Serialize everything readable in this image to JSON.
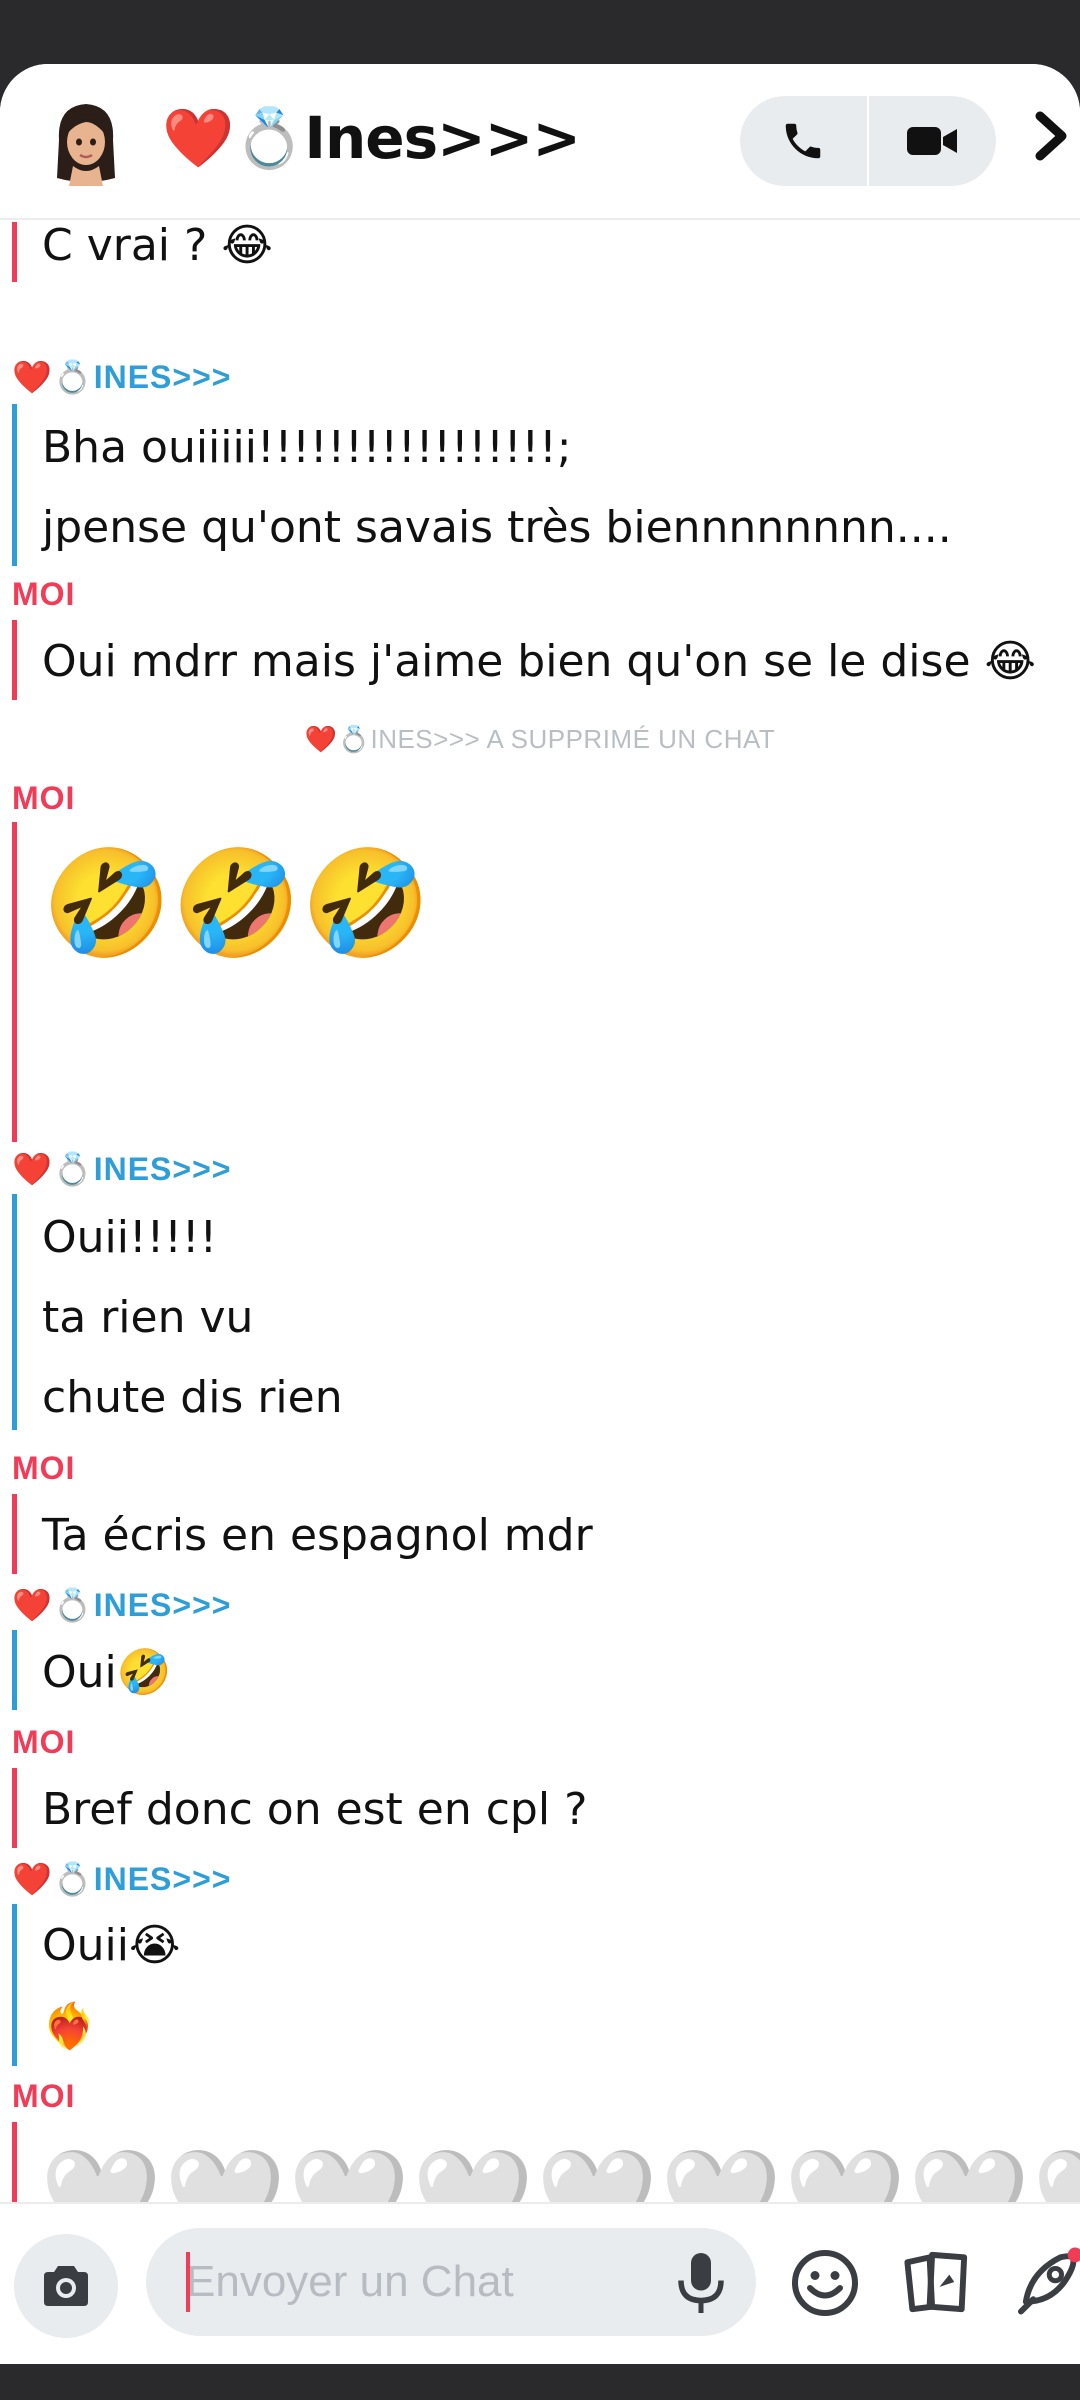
{
  "header": {
    "title": "❤️💍Ines>>>",
    "call_icon": "phone-icon",
    "video_icon": "video-camera-icon",
    "more_icon": "chevron-right-icon"
  },
  "colors": {
    "moi": "#f23c57",
    "ines": "#2d9ed8",
    "system_text": "#b9bec4",
    "pill_bg": "#e9ecef"
  },
  "chat": {
    "blocks": [
      {
        "sender": "",
        "sender_class": "moi",
        "messages": [
          "C vrai ? 😂"
        ]
      },
      {
        "sender": "❤️💍INES>>>",
        "sender_class": "ines",
        "messages": [
          "Bha ouiiiii!!!!!!!!!!!!!!!!!;",
          "jpense qu'ont savais très biennnnnnnn...."
        ]
      },
      {
        "sender": "MOI",
        "sender_class": "moi",
        "messages": [
          "Oui mdrr mais j'aime bien qu'on se le dise 😂"
        ]
      },
      {
        "system": "❤️💍INES>>> A SUPPRIMÉ UN CHAT"
      },
      {
        "sender": "MOI",
        "sender_class": "moi",
        "emoji": "🤣🤣🤣"
      },
      {
        "sender": "❤️💍INES>>>",
        "sender_class": "ines",
        "messages": [
          "Ouii!!!!!",
          "ta rien vu",
          "chute dis rien"
        ]
      },
      {
        "sender": "MOI",
        "sender_class": "moi",
        "messages": [
          "Ta écris en espagnol mdr"
        ]
      },
      {
        "sender": "❤️💍INES>>>",
        "sender_class": "ines",
        "messages": [
          "Oui🤣"
        ]
      },
      {
        "sender": "MOI",
        "sender_class": "moi",
        "messages": [
          "Bref donc on est en cpl ?"
        ]
      },
      {
        "sender": "❤️💍INES>>>",
        "sender_class": "ines",
        "messages": [
          "Ouii😭",
          "❤️‍🔥"
        ]
      },
      {
        "sender": "MOI",
        "sender_class": "moi",
        "hearts_line1": "🤍🤍🤍🤍🤍🤍🤍🤍🤍",
        "hearts_line2": "🤍"
      }
    ]
  },
  "composer": {
    "placeholder": "Envoyer un Chat",
    "camera_icon": "camera-icon",
    "mic_icon": "microphone-icon",
    "emoji_icon": "smiley-icon",
    "cards_icon": "cards-icon",
    "rocket_icon": "rocket-icon"
  }
}
